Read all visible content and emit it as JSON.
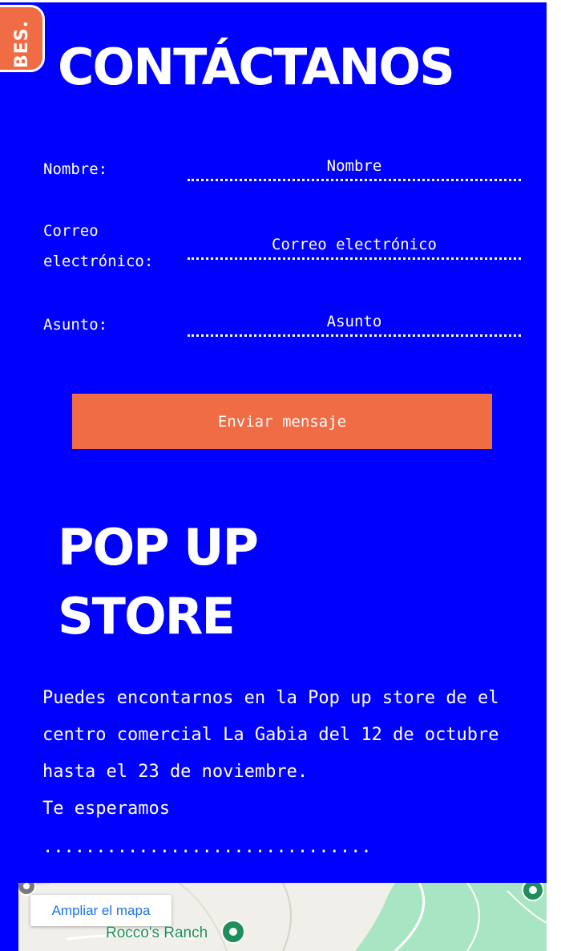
{
  "logo": {
    "text": "BES."
  },
  "contact": {
    "title": "CONTÁCTANOS",
    "fields": {
      "name": {
        "label": "Nombre:",
        "placeholder": "Nombre"
      },
      "email": {
        "label": "Correo electrónico:",
        "placeholder": "Correo electrónico"
      },
      "subject": {
        "label": "Asunto:",
        "placeholder": "Asunto"
      }
    },
    "submit_label": "Enviar mensaje"
  },
  "popup": {
    "title": "POP UP STORE",
    "lines": [
      "Puedes encontarnos en la Pop up store de el centro comercial La Gabia del 12 de octubre hasta el 23 de noviembre.",
      "Te esperamos"
    ],
    "dots": "..............................."
  },
  "map": {
    "enlarge_label": "Ampliar el mapa",
    "place_label": "Rocco's Ranch"
  },
  "colors": {
    "background": "#0000ff",
    "accent": "#ef6c45",
    "text": "#ffffff",
    "map_link": "#1a73e8",
    "map_pin": "#1e8e5a"
  }
}
